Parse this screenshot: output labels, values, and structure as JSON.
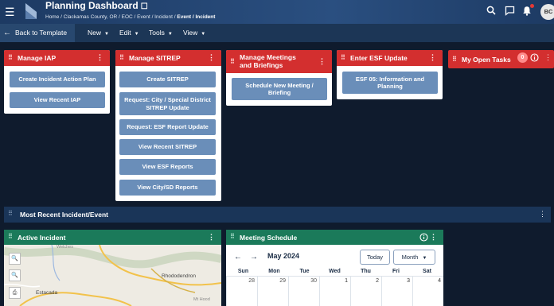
{
  "header": {
    "app_title": "Planning Dashboard",
    "favorite_glyph": "☐",
    "breadcrumb": [
      "Home",
      "Clackamas County, OR",
      "EOC",
      "Event / Incident",
      "Event / Incident"
    ],
    "breadcrumb_separator": " / ",
    "avatar_initials": "BC",
    "icons": [
      "menu-icon",
      "search-icon",
      "chat-icon",
      "bell-icon"
    ]
  },
  "toolbar": {
    "back_label": "Back to Template",
    "menus": [
      "New",
      "Edit",
      "Tools",
      "View"
    ]
  },
  "cards": {
    "manage_iap": {
      "title": "Manage IAP",
      "buttons": [
        "Create Incident Action Plan",
        "View Recent IAP"
      ]
    },
    "manage_sitrep": {
      "title": "Manage SITREP",
      "buttons": [
        "Create SITREP",
        "Request: City / Special District SITREP Update",
        "Request: ESF Report Update",
        "View Recent SITREP",
        "View ESF Reports",
        "View City/SD Reports"
      ]
    },
    "manage_meetings": {
      "title": "Manage Meetings and Briefings",
      "buttons": [
        "Schedule New Meeting / Briefing"
      ]
    },
    "esf_update": {
      "title": "Enter ESF Update",
      "buttons": [
        "ESF 05: Information and Planning"
      ]
    },
    "open_tasks": {
      "title": "My Open Tasks",
      "count": "0"
    }
  },
  "section": {
    "title": "Most Recent Incident/Event"
  },
  "active_incident": {
    "title": "Active Incident",
    "map_labels": [
      "Rhododendron",
      "Estacada",
      "Mt Hood",
      "Welches"
    ]
  },
  "meeting_schedule": {
    "title": "Meeting Schedule",
    "month": "May 2024",
    "today_label": "Today",
    "view_label": "Month",
    "days_of_week": [
      "Sun",
      "Mon",
      "Tue",
      "Wed",
      "Thu",
      "Fri",
      "Sat"
    ],
    "first_week": [
      "28",
      "29",
      "30",
      "1",
      "2",
      "3",
      "4"
    ]
  },
  "colors": {
    "background": "#0f1b2d",
    "header": "#1d3a63",
    "card_header_red": "#d32f2f",
    "card_header_green": "#1b7a5a",
    "button_blue": "#6a8eb9"
  }
}
